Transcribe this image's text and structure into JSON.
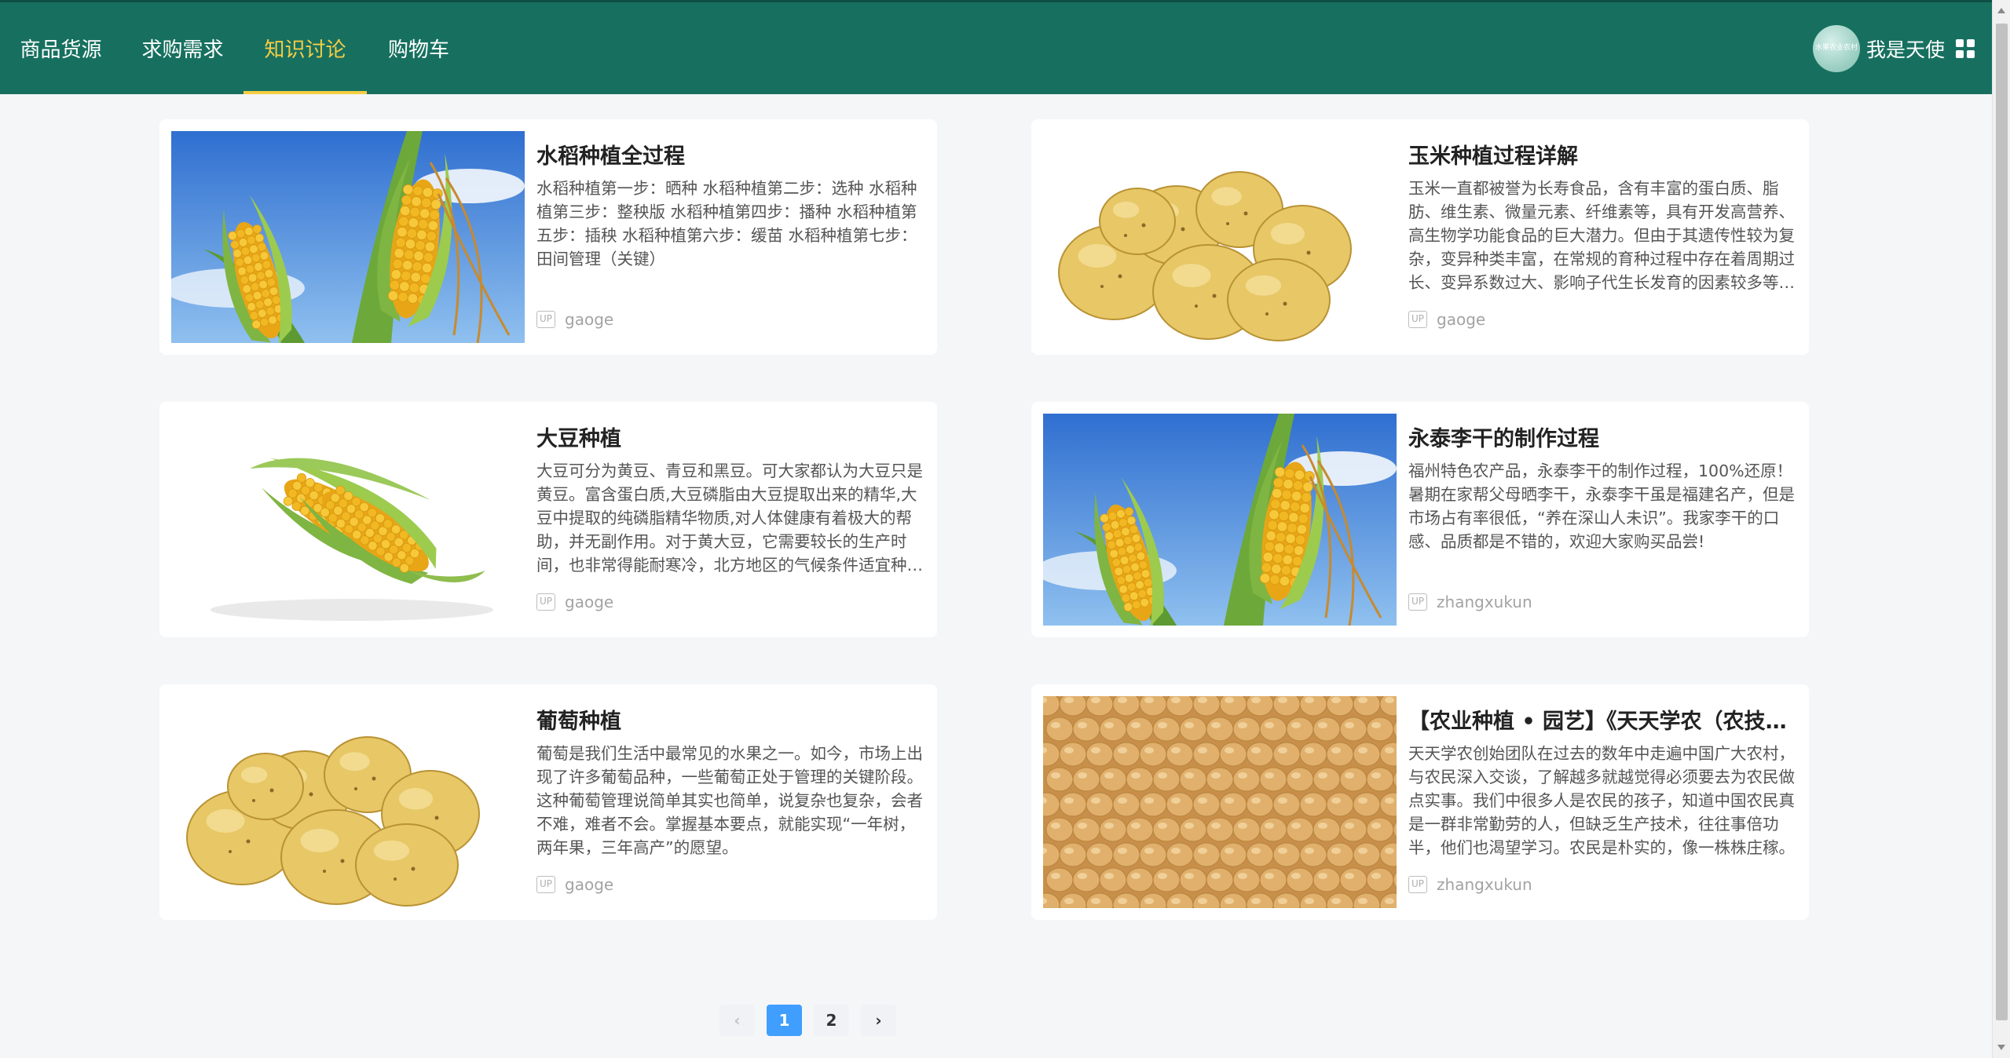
{
  "nav": {
    "items": [
      {
        "label": "商品货源",
        "active": false
      },
      {
        "label": "求购需求",
        "active": false
      },
      {
        "label": "知识讨论",
        "active": true
      },
      {
        "label": "购物车",
        "active": false
      }
    ],
    "active_color": "#f6cd45",
    "bg_color": "#17705f"
  },
  "user": {
    "avatar_text": "水果农业农村",
    "name": "我是天使",
    "menu_icon": "grid-icon"
  },
  "articles": [
    {
      "title": "水稻种植全过程",
      "desc": "水稻种植第一步：晒种 水稻种植第二步：选种 水稻种植第三步：整秧版 水稻种植第四步：播种 水稻种植第五步：插秧 水稻种植第六步：缓苗 水稻种植第七步：田间管理（关键）",
      "badge": "UP",
      "author": "gaoge",
      "image": "corn-sky"
    },
    {
      "title": "玉米种植过程详解",
      "desc": "玉米一直都被誉为长寿食品，含有丰富的蛋白质、脂肪、维生素、微量元素、纤维素等，具有开发高营养、高生物学功能食品的巨大潜力。但由于其遗传性较为复杂，变异种类丰富，在常规的育种过程中存在着周期过长、变异系数过大、影响子代生长发育的因素较多等问题。",
      "badge": "UP",
      "author": "gaoge",
      "image": "potato"
    },
    {
      "title": "大豆种植",
      "desc": "大豆可分为黄豆、青豆和黑豆。可大家都认为大豆只是黄豆。富含蛋白质,大豆磷脂由大豆提取出来的精华,大豆中提取的纯磷脂精华物质,对人体健康有着极大的帮助，并无副作用。对于黄大豆，它需要较长的生产时间，也非常得能耐寒冷，北方地区的气候条件适宜种植。",
      "badge": "UP",
      "author": "gaoge",
      "image": "corn-white"
    },
    {
      "title": "永泰李干的制作过程",
      "desc": "福州特色农产品，永泰李干的制作过程，100%还原！暑期在家帮父母晒李干，永泰李干虽是福建名产，但是市场占有率很低，“养在深山人未识”。我家李干的口感、品质都是不错的，欢迎大家购买品尝!",
      "badge": "UP",
      "author": "zhangxukun",
      "image": "corn-sky"
    },
    {
      "title": "葡萄种植",
      "desc": "葡萄是我们生活中最常见的水果之一。如今，市场上出现了许多葡萄品种，一些葡萄正处于管理的关键阶段。这种葡萄管理说简单其实也简单，说复杂也复杂，会者不难，难者不会。掌握基本要点，就能实现“一年树，两年果，三年高产”的愿望。",
      "badge": "UP",
      "author": "gaoge",
      "image": "potato"
    },
    {
      "title": "【农业种植 • 园艺】《天天学农（农技学习）》",
      "desc": "天天学农创始团队在过去的数年中走遍中国广大农村，与农民深入交谈，了解越多就越觉得必须要去为农民做点实事。我们中很多人是农民的孩子，知道中国农民真是一群非常勤劳的人，但缺乏生产技术，往往事倍功半，他们也渴望学习。农民是朴实的，像一株株庄稼。",
      "badge": "UP",
      "author": "zhangxukun",
      "image": "soybean"
    }
  ],
  "pagination": {
    "prev_icon": "chevron-left-icon",
    "pages": [
      "1",
      "2"
    ],
    "current": "1",
    "next_icon": "chevron-right-icon",
    "active_color": "#409eff"
  }
}
